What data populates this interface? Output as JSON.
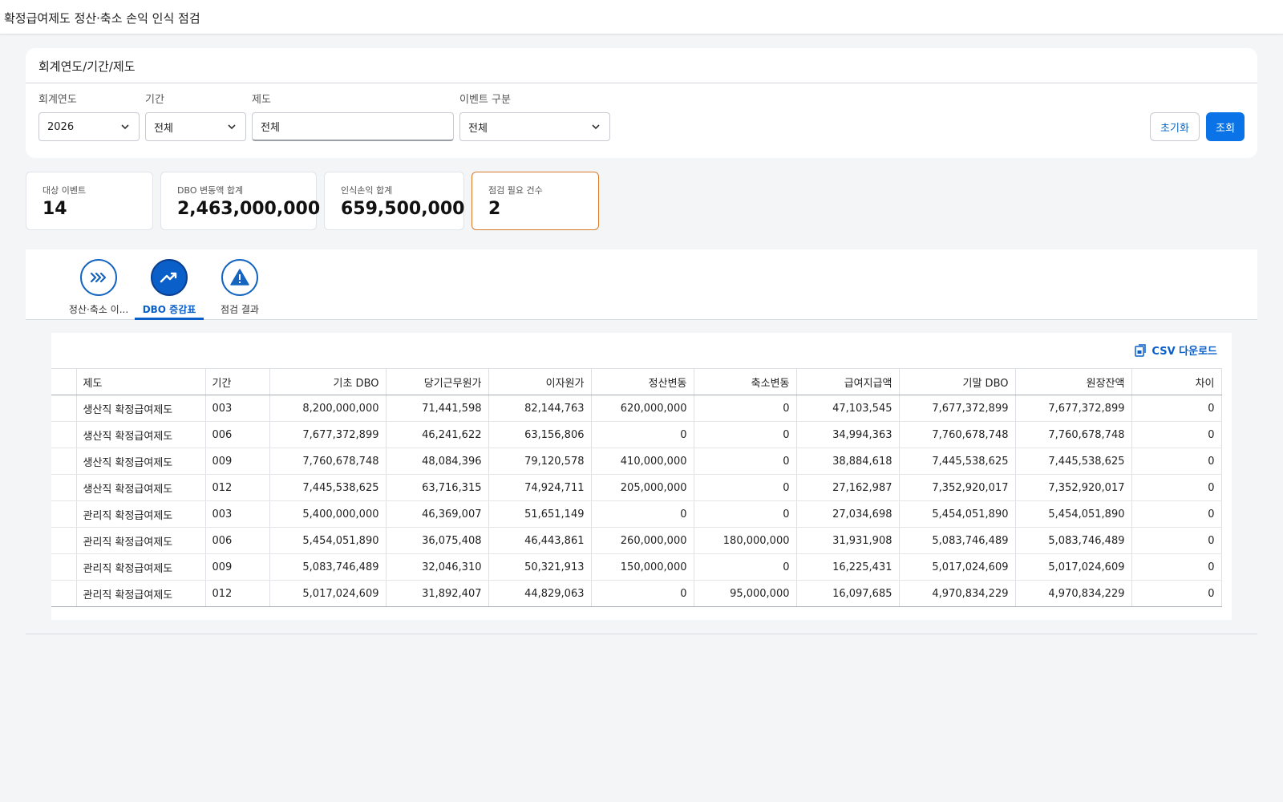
{
  "header": {
    "title": "확정급여제도 정산·축소 손익 인식 점검"
  },
  "filter": {
    "section_title": "회계연도/기간/제도",
    "fiscal_year": {
      "label": "회계연도",
      "value": "2026"
    },
    "period": {
      "label": "기간",
      "value": "전체"
    },
    "plan": {
      "label": "제도",
      "value": "전체"
    },
    "event_type": {
      "label": "이벤트 구분",
      "value": "전체"
    },
    "reset_label": "초기화",
    "search_label": "조회"
  },
  "stats": [
    {
      "label": "대상 이벤트",
      "value": "14"
    },
    {
      "label": "DBO 변동액 합계",
      "value": "2,463,000,000"
    },
    {
      "label": "인식손익 합계",
      "value": "659,500,000"
    },
    {
      "label": "점검 필요 건수",
      "value": "2"
    }
  ],
  "tabs": [
    {
      "label": "정산·축소 이...",
      "icon": "chevrons-right-icon",
      "active": false
    },
    {
      "label": "DBO 증감표",
      "icon": "trending-up-icon",
      "active": true
    },
    {
      "label": "점검 결과",
      "icon": "warning-icon",
      "active": false
    }
  ],
  "table": {
    "csv_label": "CSV 다운로드",
    "columns": [
      "제도",
      "기간",
      "기초 DBO",
      "당기근무원가",
      "이자원가",
      "정산변동",
      "축소변동",
      "급여지급액",
      "기말 DBO",
      "원장잔액",
      "차이"
    ],
    "rows": [
      [
        "생산직 확정급여제도",
        "003",
        "8,200,000,000",
        "71,441,598",
        "82,144,763",
        "620,000,000",
        "0",
        "47,103,545",
        "7,677,372,899",
        "7,677,372,899",
        "0"
      ],
      [
        "생산직 확정급여제도",
        "006",
        "7,677,372,899",
        "46,241,622",
        "63,156,806",
        "0",
        "0",
        "34,994,363",
        "7,760,678,748",
        "7,760,678,748",
        "0"
      ],
      [
        "생산직 확정급여제도",
        "009",
        "7,760,678,748",
        "48,084,396",
        "79,120,578",
        "410,000,000",
        "0",
        "38,884,618",
        "7,445,538,625",
        "7,445,538,625",
        "0"
      ],
      [
        "생산직 확정급여제도",
        "012",
        "7,445,538,625",
        "63,716,315",
        "74,924,711",
        "205,000,000",
        "0",
        "27,162,987",
        "7,352,920,017",
        "7,352,920,017",
        "0"
      ],
      [
        "관리직 확정급여제도",
        "003",
        "5,400,000,000",
        "46,369,007",
        "51,651,149",
        "0",
        "0",
        "27,034,698",
        "5,454,051,890",
        "5,454,051,890",
        "0"
      ],
      [
        "관리직 확정급여제도",
        "006",
        "5,454,051,890",
        "36,075,408",
        "46,443,861",
        "260,000,000",
        "180,000,000",
        "31,931,908",
        "5,083,746,489",
        "5,083,746,489",
        "0"
      ],
      [
        "관리직 확정급여제도",
        "009",
        "5,083,746,489",
        "32,046,310",
        "50,321,913",
        "150,000,000",
        "0",
        "16,225,431",
        "5,017,024,609",
        "5,017,024,609",
        "0"
      ],
      [
        "관리직 확정급여제도",
        "012",
        "5,017,024,609",
        "31,892,407",
        "44,829,063",
        "0",
        "95,000,000",
        "16,097,685",
        "4,970,834,229",
        "4,970,834,229",
        "0"
      ]
    ]
  },
  "colors": {
    "primary": "#0a73e8",
    "warning_border": "#d97a2b"
  }
}
